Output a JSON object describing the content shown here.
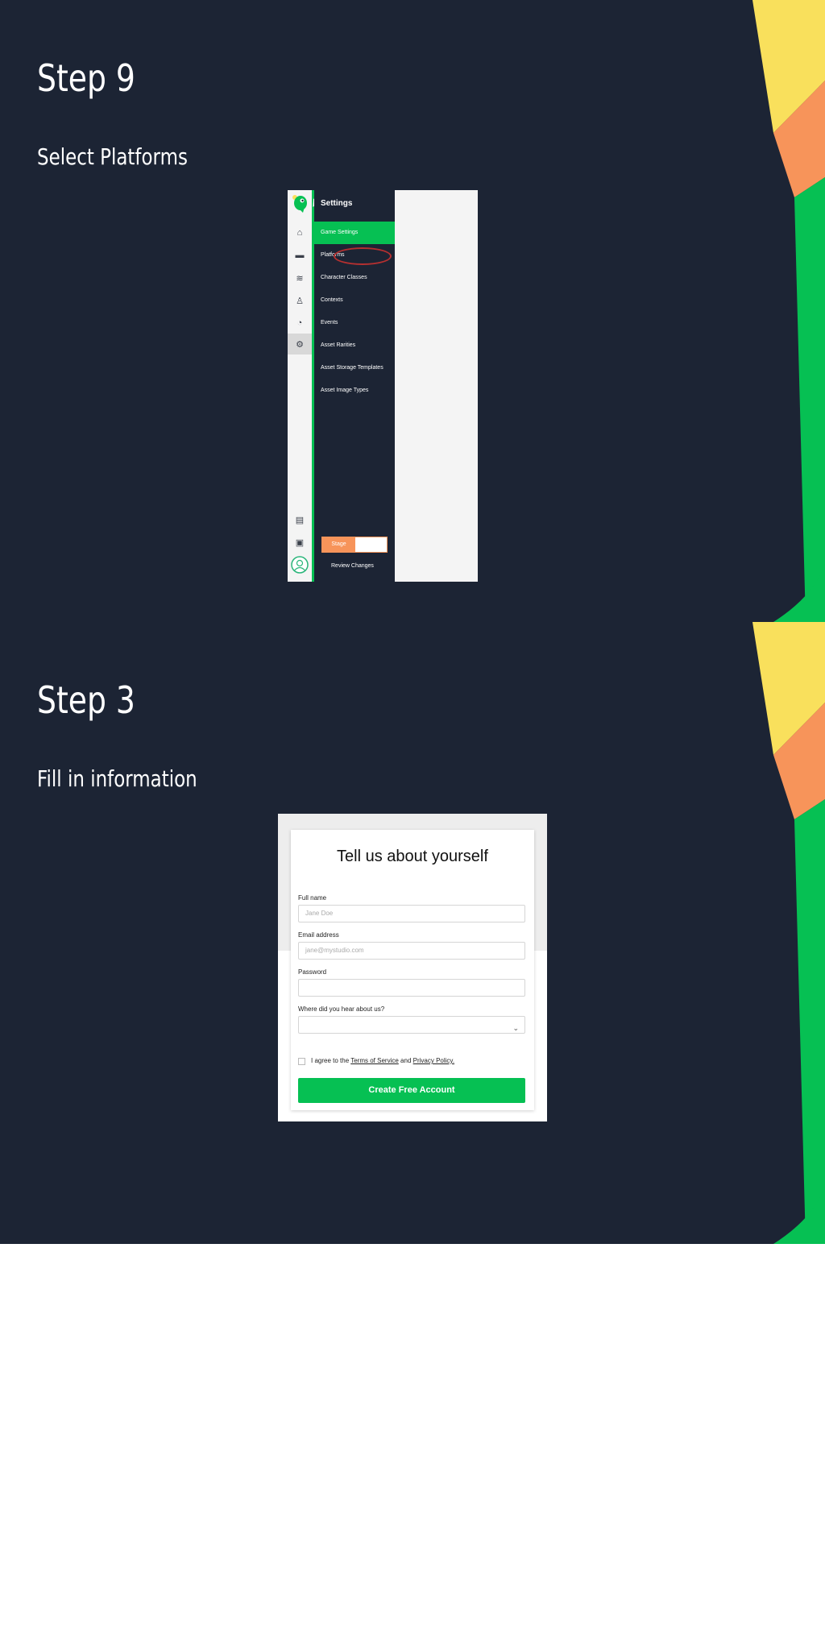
{
  "slides": [
    {
      "title": "Step 9",
      "subtitle": "Select Platforms"
    },
    {
      "title": "Step 3",
      "subtitle": "Fill in information"
    }
  ],
  "settings_app": {
    "header": "Settings",
    "menu_items": [
      "Game Settings",
      "Platforms",
      "Character Classes",
      "Contexts",
      "Events",
      "Asset Rarities",
      "Asset Storage Templates",
      "Asset Image Types"
    ],
    "active_item": "Game Settings",
    "highlighted_item": "Platforms",
    "stage_label": "Stage",
    "review_label": "Review Changes",
    "rail_icons": [
      "home-icon",
      "gamepad-icon",
      "layers-icon",
      "character-icon",
      "dashboard-icon",
      "gear-icon",
      "book-icon",
      "chat-icon",
      "avatar-icon"
    ]
  },
  "signup_form": {
    "title": "Tell us about yourself",
    "full_name_label": "Full name",
    "full_name_placeholder": "Jane Doe",
    "email_label": "Email address",
    "email_placeholder": "jane@mystudio.com",
    "password_label": "Password",
    "source_label": "Where did you hear about us?",
    "agree_prefix": "I agree to the",
    "terms_link": "Terms of Service",
    "and_text": "and",
    "privacy_link": "Privacy Policy.",
    "submit_label": "Create Free Account"
  },
  "colors": {
    "slide_bg": "#1c2434",
    "accent_green": "#06c053",
    "accent_yellow": "#f9e05c",
    "accent_orange": "#f7945a",
    "highlight_ring": "#b53030"
  }
}
